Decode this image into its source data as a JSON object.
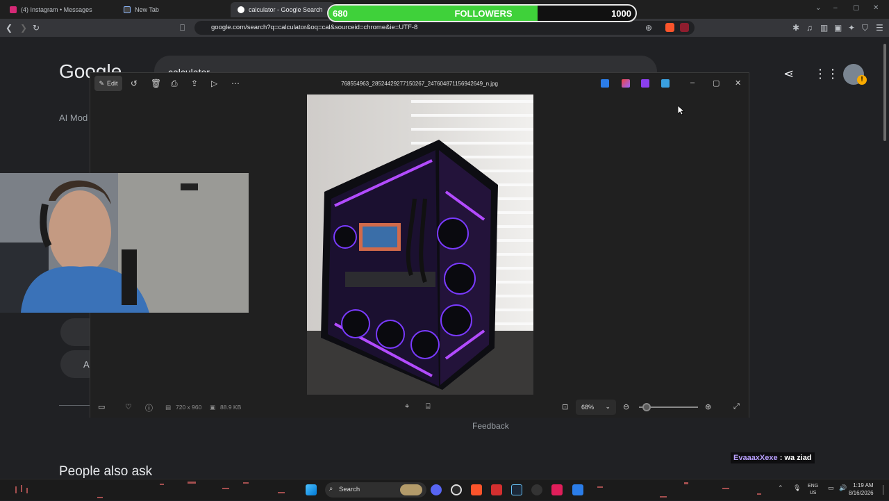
{
  "browser": {
    "tabs": [
      {
        "label": "(4) Instagram • Messages",
        "color": "#d62976"
      },
      {
        "label": "New Tab",
        "color": "#8ab4f8"
      },
      {
        "label": "calculator - Google Search",
        "color": "#ffffff"
      }
    ],
    "url": "google.com/search?q=calculator&oq=cal&sourceid=chrome&ie=UTF-8"
  },
  "followers": {
    "current": "680",
    "label": "FOLLOWERS",
    "goal": "1000",
    "progress": 0.68,
    "fill_color": "#3fd13a"
  },
  "google": {
    "logo": "Google",
    "query": "calculator",
    "ai_mode": "AI Mod",
    "feedback": "Feedback",
    "people_also_ask": "People also ask",
    "pill_letter": "A"
  },
  "viewer": {
    "edit_label": "Edit",
    "file_name": "768554963_28524429277150267_247604871156942649_n.jpg",
    "dimensions": "720 x 960",
    "file_size": "88.9 KB",
    "zoom": "68%"
  },
  "chat": {
    "user": "EvaaaxXexe",
    "message": ": wa ziad"
  },
  "taskbar": {
    "search_label": "Search",
    "lang": "ENG",
    "region": "US",
    "time": "1:19 AM",
    "date": "8/16/2026"
  }
}
